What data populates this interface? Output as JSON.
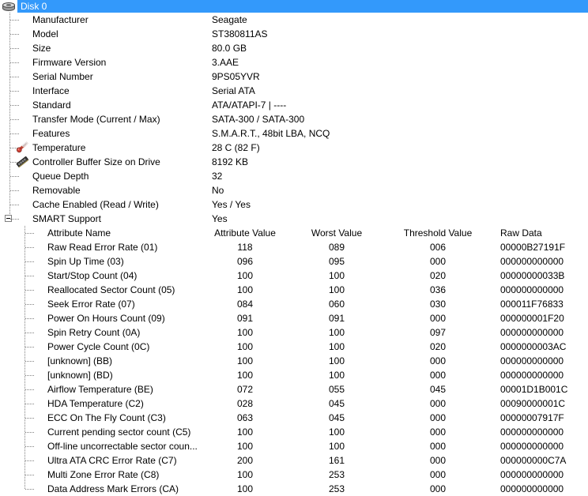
{
  "tree": {
    "root": {
      "label": "Disk 0",
      "icon": "disk-platter-icon",
      "selected": true,
      "highlight_color": "#3399fb",
      "text_color": "#ffffff"
    },
    "properties": [
      {
        "label": "Manufacturer",
        "value": "Seagate"
      },
      {
        "label": "Model",
        "value": "ST380811AS"
      },
      {
        "label": "Size",
        "value": "80.0 GB"
      },
      {
        "label": "Firmware Version",
        "value": "3.AAE"
      },
      {
        "label": "Serial Number",
        "value": "9PS05YVR"
      },
      {
        "label": "Interface",
        "value": "Serial ATA"
      },
      {
        "label": "Standard",
        "value": "ATA/ATAPI-7 | ----"
      },
      {
        "label": "Transfer Mode (Current / Max)",
        "value": "SATA-300 / SATA-300"
      },
      {
        "label": "Features",
        "value": "S.M.A.R.T., 48bit LBA, NCQ"
      },
      {
        "label": "Temperature",
        "value": "28 C (82 F)",
        "icon": "thermometer-icon"
      },
      {
        "label": "Controller Buffer Size on Drive",
        "value": "8192 KB",
        "icon": "memory-module-icon"
      },
      {
        "label": "Queue Depth",
        "value": "32"
      },
      {
        "label": "Removable",
        "value": "No"
      },
      {
        "label": "Cache Enabled (Read / Write)",
        "value": "Yes / Yes"
      },
      {
        "label": "SMART Support",
        "value": "Yes",
        "expandable": true,
        "expanded": true
      }
    ]
  },
  "smart_table": {
    "headers": {
      "name": "Attribute Name",
      "attribute_value": "Attribute Value",
      "worst_value": "Worst Value",
      "threshold_value": "Threshold Value",
      "raw_data": "Raw Data"
    },
    "rows": [
      {
        "name": "Raw Read Error Rate (01)",
        "attribute_value": "118",
        "worst_value": "089",
        "threshold_value": "006",
        "raw_data": "00000B27191F"
      },
      {
        "name": "Spin Up Time (03)",
        "attribute_value": "096",
        "worst_value": "095",
        "threshold_value": "000",
        "raw_data": "000000000000"
      },
      {
        "name": "Start/Stop Count (04)",
        "attribute_value": "100",
        "worst_value": "100",
        "threshold_value": "020",
        "raw_data": "00000000033B"
      },
      {
        "name": "Reallocated Sector Count (05)",
        "attribute_value": "100",
        "worst_value": "100",
        "threshold_value": "036",
        "raw_data": "000000000000"
      },
      {
        "name": "Seek Error Rate (07)",
        "attribute_value": "084",
        "worst_value": "060",
        "threshold_value": "030",
        "raw_data": "000011F76833"
      },
      {
        "name": "Power On Hours Count (09)",
        "attribute_value": "091",
        "worst_value": "091",
        "threshold_value": "000",
        "raw_data": "000000001F20"
      },
      {
        "name": "Spin Retry Count (0A)",
        "attribute_value": "100",
        "worst_value": "100",
        "threshold_value": "097",
        "raw_data": "000000000000"
      },
      {
        "name": "Power Cycle Count (0C)",
        "attribute_value": "100",
        "worst_value": "100",
        "threshold_value": "020",
        "raw_data": "0000000003AC"
      },
      {
        "name": "[unknown] (BB)",
        "attribute_value": "100",
        "worst_value": "100",
        "threshold_value": "000",
        "raw_data": "000000000000"
      },
      {
        "name": "[unknown] (BD)",
        "attribute_value": "100",
        "worst_value": "100",
        "threshold_value": "000",
        "raw_data": "000000000000"
      },
      {
        "name": "Airflow Temperature (BE)",
        "attribute_value": "072",
        "worst_value": "055",
        "threshold_value": "045",
        "raw_data": "00001D1B001C"
      },
      {
        "name": "HDA Temperature (C2)",
        "attribute_value": "028",
        "worst_value": "045",
        "threshold_value": "000",
        "raw_data": "00090000001C"
      },
      {
        "name": "ECC On The Fly Count (C3)",
        "attribute_value": "063",
        "worst_value": "045",
        "threshold_value": "000",
        "raw_data": "00000007917F"
      },
      {
        "name": "Current pending sector count (C5)",
        "attribute_value": "100",
        "worst_value": "100",
        "threshold_value": "000",
        "raw_data": "000000000000"
      },
      {
        "name": "Off-line uncorrectable sector coun...",
        "attribute_value": "100",
        "worst_value": "100",
        "threshold_value": "000",
        "raw_data": "000000000000"
      },
      {
        "name": "Ultra ATA CRC Error Rate (C7)",
        "attribute_value": "200",
        "worst_value": "161",
        "threshold_value": "000",
        "raw_data": "000000000C7A"
      },
      {
        "name": "Multi Zone Error Rate (C8)",
        "attribute_value": "100",
        "worst_value": "253",
        "threshold_value": "000",
        "raw_data": "000000000000"
      },
      {
        "name": "Data Address Mark Errors (CA)",
        "attribute_value": "100",
        "worst_value": "253",
        "threshold_value": "000",
        "raw_data": "000000000000"
      }
    ]
  }
}
